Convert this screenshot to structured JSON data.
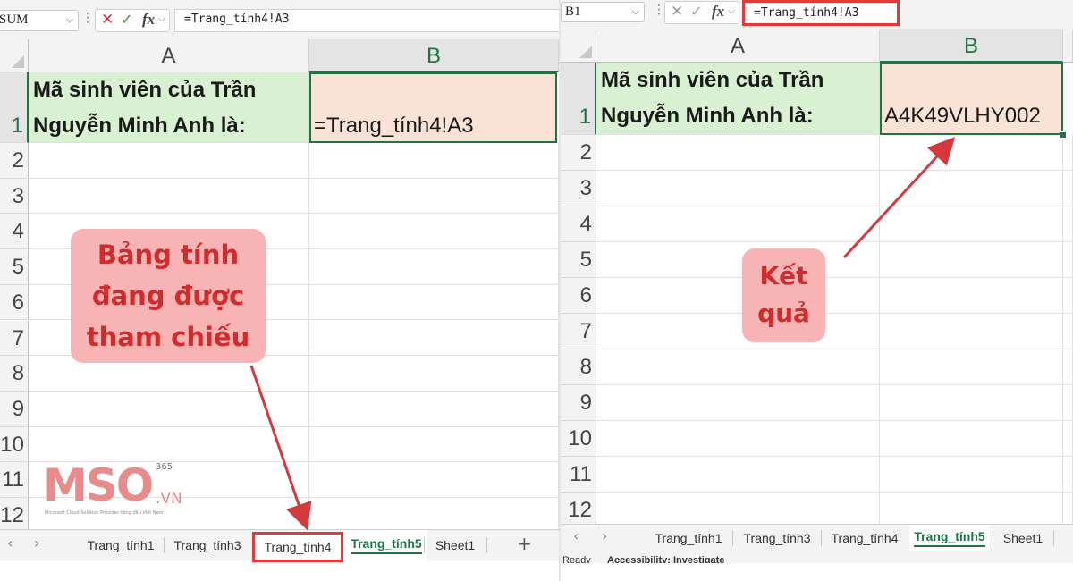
{
  "left": {
    "name_box": "SUM",
    "formula": "=Trang_tính4!A3",
    "columns": [
      "A",
      "B"
    ],
    "rows": [
      "1",
      "2",
      "3",
      "4",
      "5",
      "6",
      "7",
      "8",
      "9",
      "10",
      "11",
      "12"
    ],
    "cell_a1_line1": "Mã sinh viên của Trần",
    "cell_a1_line2": "Nguyễn Minh Anh là:",
    "cell_b1": "=Trang_tính4!A3",
    "tabs": [
      "Trang_tính1",
      "Trang_tính3",
      "Trang_tính4",
      "Trang_tính5",
      "Sheet1"
    ],
    "active_tab": "Trang_tính5",
    "highlighted_tab": "Trang_tính4",
    "callout_lines": [
      "Bảng tính",
      "đang được",
      "tham chiếu"
    ]
  },
  "right": {
    "name_box": "B1",
    "formula": "=Trang_tính4!A3",
    "columns": [
      "A",
      "B"
    ],
    "rows": [
      "1",
      "2",
      "3",
      "4",
      "5",
      "6",
      "7",
      "8",
      "9",
      "10",
      "11",
      "12"
    ],
    "cell_a1_line1": "Mã sinh viên của Trần",
    "cell_a1_line2": "Nguyễn Minh Anh là:",
    "cell_b1": "A4K49VLHY002",
    "tabs": [
      "Trang_tính1",
      "Trang_tính3",
      "Trang_tính4",
      "Trang_tính5",
      "Sheet1"
    ],
    "active_tab": "Trang_tính5",
    "status_ready": "Ready",
    "status_accessibility": "Accessibility: Investigate",
    "callout_lines": [
      "Kết",
      "quả"
    ]
  },
  "logo": {
    "text": "MSO",
    "domain": ".VN",
    "superscript": "365",
    "tagline": "Microsoft Cloud Solution Provider hàng đầu Việt Nam"
  },
  "icons": {
    "cancel": "✕",
    "enter": "✓",
    "function": "fx",
    "dropdown": "⌵",
    "nav_prev": "‹",
    "nav_next": "›",
    "add_sheet": "+",
    "more": "⋮"
  },
  "colors": {
    "accent_green": "#217346",
    "label_cell": "#d9f0d3",
    "value_cell": "#fbe2d6",
    "annotation_red": "#e03a3a",
    "callout_bg": "#f8b4b4",
    "callout_text": "#d02c2c"
  }
}
